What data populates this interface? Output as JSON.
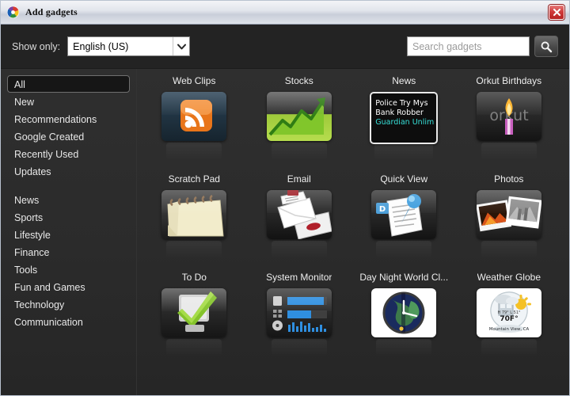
{
  "window": {
    "title": "Add gadgets",
    "app_icon": "google-desktop-icon",
    "close_label": "×"
  },
  "toolbar": {
    "show_only_label": "Show only:",
    "language_value": "English (US)",
    "language_options": [
      "English (US)"
    ],
    "search_placeholder": "Search gadgets",
    "search_value": "",
    "search_button_icon": "search-icon"
  },
  "sidebar": {
    "selected": "All",
    "groups": [
      {
        "items": [
          "All",
          "New",
          "Recommendations",
          "Google Created",
          "Recently Used",
          "Updates"
        ]
      },
      {
        "items": [
          "News",
          "Sports",
          "Lifestyle",
          "Finance",
          "Tools",
          "Fun and Games",
          "Technology",
          "Communication"
        ]
      }
    ]
  },
  "gadgets": [
    {
      "label": "Web Clips",
      "icon": "rss-icon"
    },
    {
      "label": "Stocks",
      "icon": "stock-chart-icon"
    },
    {
      "label": "News",
      "icon": "news-headlines-icon",
      "headlines": [
        "Police Try Mys",
        "Bank Robber",
        "Guardian Unlim"
      ]
    },
    {
      "label": "Orkut Birthdays",
      "icon": "orkut-candle-icon",
      "wordmark": "orkut"
    },
    {
      "label": "Scratch Pad",
      "icon": "notepad-icon"
    },
    {
      "label": "Email",
      "icon": "envelope-icon"
    },
    {
      "label": "Quick View",
      "icon": "pushpin-document-icon",
      "badge": "D"
    },
    {
      "label": "Photos",
      "icon": "photo-stack-icon"
    },
    {
      "label": "To Do",
      "icon": "checkmark-icon"
    },
    {
      "label": "System Monitor",
      "icon": "system-meters-icon"
    },
    {
      "label": "Day Night World Cl...",
      "icon": "world-clock-icon"
    },
    {
      "label": "Weather Globe",
      "icon": "weather-globe-icon",
      "temperature": "70F°",
      "hi_lo": "H 79°  L 51°",
      "location": "Mountain View, CA"
    }
  ],
  "colors": {
    "window_bg": "#2b2b2b",
    "toolbar_bg": "#232323",
    "text": "#e8e8e8",
    "accent_rss": "#f08020",
    "accent_stock": "#8cc63f",
    "accent_link": "#37e0d8",
    "close_red": "#cf3b3b"
  }
}
